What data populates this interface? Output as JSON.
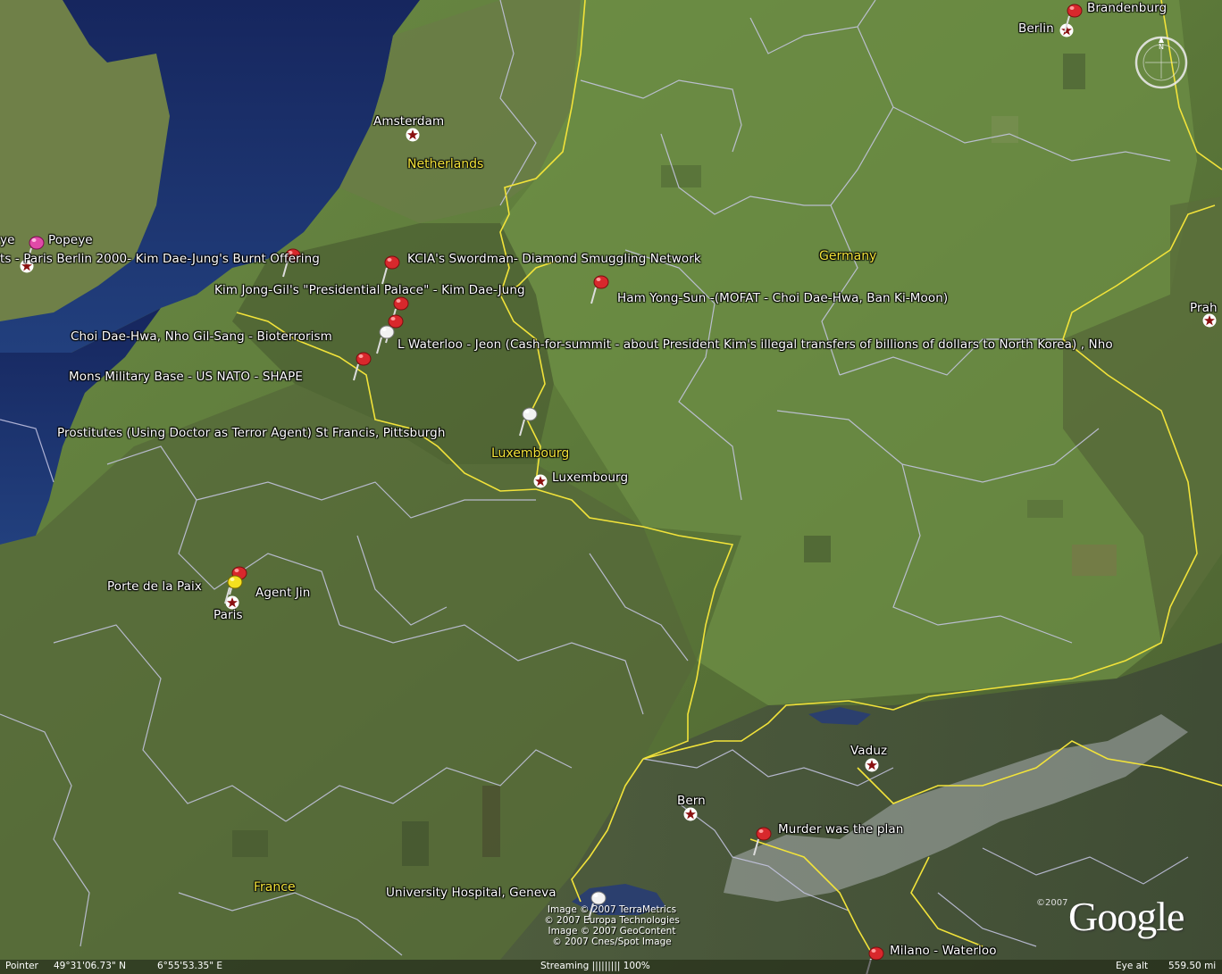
{
  "places": {
    "brandenburg": "Brandenburg",
    "berlin": "Berlin",
    "praha": "Prah",
    "amsterdam": "Amsterdam",
    "luxembourg_city": "Luxembourg",
    "paris": "Paris",
    "bern": "Bern",
    "vaduz": "Vaduz"
  },
  "countries": {
    "netherlands": "Netherlands",
    "germany": "Germany",
    "luxembourg": "Luxembourg",
    "france": "France"
  },
  "placemarks": {
    "popeye": "Popeye",
    "popeye_partial": "ye",
    "paris_berlin": "ts  - Paris Berlin 2000- Kim Dae-Jung's Burnt Offering",
    "kcia": "KCIA's Swordman- Diamond Smuggling Network",
    "kim_jong_gil": "Kim Jong-Gil's \"Presidential Palace\" - Kim Dae-Jung",
    "ham_yong_sun": "Ham Yong-Sun -(MOFAT - Choi Dae-Hwa, Ban Ki-Moon)",
    "choi_dae_hwa": "Choi Dae-Hwa, Nho Gil-Sang - Bioterrorism",
    "waterloo": "L Waterloo - Jeon (Cash-for-summit - about President Kim's illegal transfers of billions of dollars to North Korea) , Nho",
    "mons": "Mons Military Base - US NATO - SHAPE",
    "prostitutes": "Prostitutes (Using Doctor as Terror Agent) St Francis, Pittsburgh",
    "porte_de_la_paix": "Porte de la Paix",
    "agent_jin": "Agent Jin",
    "murder": "Murder was the plan",
    "university_hospital": "University Hospital, Geneva",
    "milano": "Milano - Waterloo"
  },
  "credits": [
    "Image © 2007 TerraMetrics",
    "© 2007 Europa Technologies",
    "Image © 2007 GeoContent",
    "© 2007 Cnes/Spot Image"
  ],
  "logo": {
    "text": "Google",
    "copyright": "©2007"
  },
  "status": {
    "pointer_label": "Pointer",
    "lat": "49°31'06.73\" N",
    "lon": "6°55'53.35\" E",
    "streaming": "Streaming ||||||||| 100%",
    "eye_alt_label": "Eye alt",
    "eye_alt_value": "559.50 mi"
  },
  "colors": {
    "sea": "#1b2f6e",
    "land": "#5f7a3c",
    "border_country": "#f2e33a",
    "border_region": "#c8c8e6",
    "pin_red": "#d8282c",
    "pin_yellow": "#f4e020",
    "pin_white": "#f2f2f2",
    "star": "#8a1010"
  }
}
